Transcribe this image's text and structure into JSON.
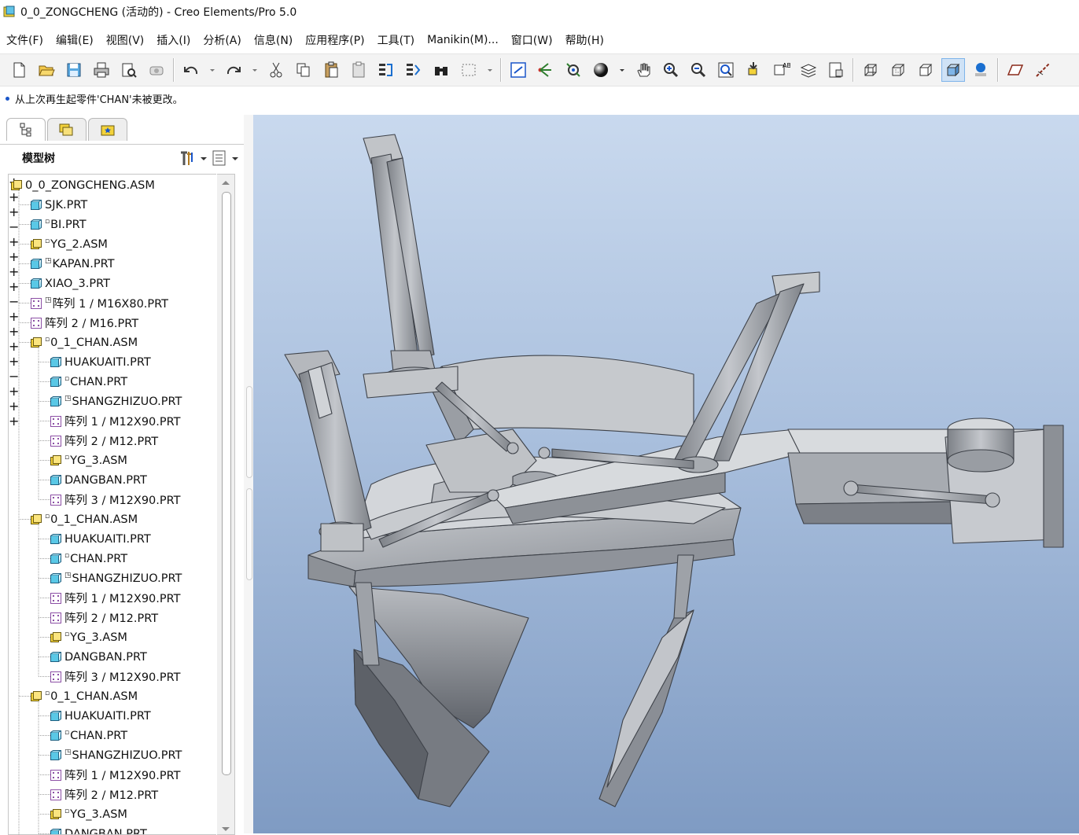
{
  "window": {
    "title": "0_0_ZONGCHENG (活动的) - Creo Elements/Pro 5.0"
  },
  "menu": [
    "文件(F)",
    "编辑(E)",
    "视图(V)",
    "插入(I)",
    "分析(A)",
    "信息(N)",
    "应用程序(P)",
    "工具(T)",
    "Manikin(M)...",
    "窗口(W)",
    "帮助(H)"
  ],
  "toolbar": {
    "icons": [
      "new-icon",
      "open-icon",
      "save-icon",
      "print-icon",
      "print-preview-icon",
      "email-icon",
      "undo-icon",
      "redo-icon",
      "cut-icon",
      "copy-icon",
      "paste-icon",
      "paste-special-icon",
      "regenerate-icon",
      "regen-manager-icon",
      "find-icon",
      "select-box-icon",
      "repaint-icon",
      "spin-center-icon",
      "view-manager-icon",
      "appearance-icon",
      "pan-icon",
      "zoom-in-icon",
      "zoom-out-icon",
      "refit-icon",
      "reorient-icon",
      "saved-views-icon",
      "layers-icon",
      "model-display-icon",
      "wireframe-icon",
      "hidden-line-icon",
      "no-hidden-icon",
      "shading-icon",
      "enhanced-realism-icon",
      "datum-plane-icon",
      "datum-axis-icon"
    ]
  },
  "message": "从上次再生起零件'CHAN'未被更改。",
  "panel": {
    "title": "模型树",
    "tabs": [
      "model-tree-tab",
      "folder-browser-tab",
      "favorites-tab"
    ]
  },
  "colors": {
    "accent": "#1a56c9",
    "asm_icon": "#f3d23a",
    "prt_icon": "#5ac8e6",
    "pattern_icon": "#9c5fb0"
  },
  "tree": [
    {
      "label": "0_0_ZONGCHENG.ASM",
      "type": "asm",
      "level": 0,
      "exp": "",
      "flag": ""
    },
    {
      "label": "SJK.PRT",
      "type": "prt",
      "level": 1,
      "exp": "",
      "flag": ""
    },
    {
      "label": "BI.PRT",
      "type": "prt",
      "level": 1,
      "exp": "",
      "flag": "▫"
    },
    {
      "label": "YG_2.ASM",
      "type": "asm",
      "level": 1,
      "exp": "+",
      "flag": "▫"
    },
    {
      "label": "KAPAN.PRT",
      "type": "prt",
      "level": 1,
      "exp": "",
      "flag": "◳"
    },
    {
      "label": "XIAO_3.PRT",
      "type": "prt",
      "level": 1,
      "exp": "",
      "flag": ""
    },
    {
      "label": "阵列 1 / M16X80.PRT",
      "type": "pat",
      "level": 1,
      "exp": "+",
      "flag": "◳"
    },
    {
      "label": "阵列 2 / M16.PRT",
      "type": "pat",
      "level": 1,
      "exp": "+",
      "flag": ""
    },
    {
      "label": "0_1_CHAN.ASM",
      "type": "asm",
      "level": 1,
      "exp": "−",
      "flag": "▫"
    },
    {
      "label": "HUAKUAITI.PRT",
      "type": "prt",
      "level": 2,
      "exp": "",
      "flag": ""
    },
    {
      "label": "CHAN.PRT",
      "type": "prt",
      "level": 2,
      "exp": "",
      "flag": "▫"
    },
    {
      "label": "SHANGZHIZUO.PRT",
      "type": "prt",
      "level": 2,
      "exp": "",
      "flag": "◳"
    },
    {
      "label": "阵列 1 / M12X90.PRT",
      "type": "pat",
      "level": 2,
      "exp": "+",
      "flag": ""
    },
    {
      "label": "阵列 2 / M12.PRT",
      "type": "pat",
      "level": 2,
      "exp": "+",
      "flag": ""
    },
    {
      "label": "YG_3.ASM",
      "type": "asm",
      "level": 2,
      "exp": "+",
      "flag": "▫"
    },
    {
      "label": "DANGBAN.PRT",
      "type": "prt",
      "level": 2,
      "exp": "",
      "flag": ""
    },
    {
      "label": "阵列 3 / M12X90.PRT",
      "type": "pat",
      "level": 2,
      "exp": "+",
      "flag": ""
    },
    {
      "label": "0_1_CHAN.ASM",
      "type": "asm",
      "level": 1,
      "exp": "−",
      "flag": "▫"
    },
    {
      "label": "HUAKUAITI.PRT",
      "type": "prt",
      "level": 2,
      "exp": "",
      "flag": ""
    },
    {
      "label": "CHAN.PRT",
      "type": "prt",
      "level": 2,
      "exp": "",
      "flag": "▫"
    },
    {
      "label": "SHANGZHIZUO.PRT",
      "type": "prt",
      "level": 2,
      "exp": "",
      "flag": "◳"
    },
    {
      "label": "阵列 1 / M12X90.PRT",
      "type": "pat",
      "level": 2,
      "exp": "+",
      "flag": ""
    },
    {
      "label": "阵列 2 / M12.PRT",
      "type": "pat",
      "level": 2,
      "exp": "+",
      "flag": ""
    },
    {
      "label": "YG_3.ASM",
      "type": "asm",
      "level": 2,
      "exp": "+",
      "flag": "▫"
    },
    {
      "label": "DANGBAN.PRT",
      "type": "prt",
      "level": 2,
      "exp": "",
      "flag": ""
    },
    {
      "label": "阵列 3 / M12X90.PRT",
      "type": "pat",
      "level": 2,
      "exp": "+",
      "flag": ""
    },
    {
      "label": "0_1_CHAN.ASM",
      "type": "asm",
      "level": 1,
      "exp": "−",
      "flag": "▫"
    },
    {
      "label": "HUAKUAITI.PRT",
      "type": "prt",
      "level": 2,
      "exp": "",
      "flag": ""
    },
    {
      "label": "CHAN.PRT",
      "type": "prt",
      "level": 2,
      "exp": "",
      "flag": "▫"
    },
    {
      "label": "SHANGZHIZUO.PRT",
      "type": "prt",
      "level": 2,
      "exp": "",
      "flag": "◳"
    },
    {
      "label": "阵列 1 / M12X90.PRT",
      "type": "pat",
      "level": 2,
      "exp": "+",
      "flag": ""
    },
    {
      "label": "阵列 2 / M12.PRT",
      "type": "pat",
      "level": 2,
      "exp": "+",
      "flag": ""
    },
    {
      "label": "YG_3.ASM",
      "type": "asm",
      "level": 2,
      "exp": "+",
      "flag": "▫"
    },
    {
      "label": "DANGBAN.PRT",
      "type": "prt",
      "level": 2,
      "exp": "",
      "flag": ""
    }
  ]
}
